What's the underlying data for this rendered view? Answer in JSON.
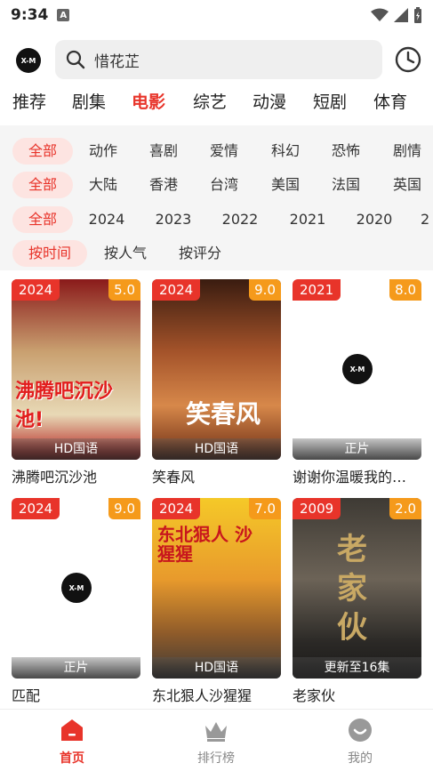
{
  "status_bar": {
    "time": "9:34",
    "notification_letter": "A"
  },
  "header": {
    "logo_text": "X-M",
    "search_text": "惜花芷"
  },
  "tabs": [
    "推荐",
    "剧集",
    "电影",
    "综艺",
    "动漫",
    "短剧",
    "体育"
  ],
  "active_tab": "电影",
  "filters": {
    "genre": [
      "全部",
      "动作",
      "喜剧",
      "爱情",
      "科幻",
      "恐怖",
      "剧情"
    ],
    "region": [
      "全部",
      "大陆",
      "香港",
      "台湾",
      "美国",
      "法国",
      "英国"
    ],
    "year": [
      "全部",
      "2024",
      "2023",
      "2022",
      "2021",
      "2020",
      "2"
    ],
    "sort": [
      "按时间",
      "按人气",
      "按评分"
    ]
  },
  "movies": [
    {
      "year": "2024",
      "score": "5.0",
      "label": "HD国语",
      "title": "沸腾吧沉沙池",
      "art": "沸腾吧沉沙池!"
    },
    {
      "year": "2024",
      "score": "9.0",
      "label": "HD国语",
      "title": "笑春风",
      "art": "笑春风"
    },
    {
      "year": "2021",
      "score": "8.0",
      "label": "正片",
      "title": "谢谢你温暖我的…",
      "art": ""
    },
    {
      "year": "2024",
      "score": "9.0",
      "label": "正片",
      "title": "匹配",
      "art": ""
    },
    {
      "year": "2024",
      "score": "7.0",
      "label": "HD国语",
      "title": "东北狠人沙猩猩",
      "art": "东北狠人 沙猩猩"
    },
    {
      "year": "2009",
      "score": "2.0",
      "label": "更新至16集",
      "title": "老家伙",
      "art": "老家伙"
    }
  ],
  "bottom_nav": [
    {
      "label": "首页",
      "icon": "home-icon"
    },
    {
      "label": "排行榜",
      "icon": "crown-icon"
    },
    {
      "label": "我的",
      "icon": "smile-icon"
    }
  ],
  "colors": {
    "accent": "#e8342a",
    "score_badge": "#f59a1b",
    "chip_active_bg": "#fde4e1"
  }
}
